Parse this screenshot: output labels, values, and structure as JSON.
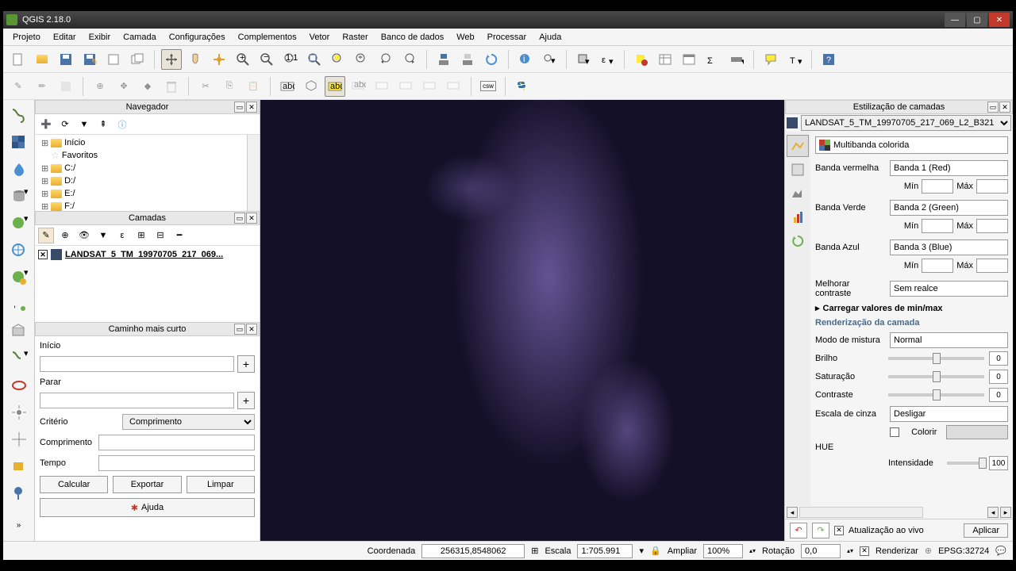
{
  "title": "QGIS 2.18.0",
  "menu": [
    "Projeto",
    "Editar",
    "Exibir",
    "Camada",
    "Configurações",
    "Complementos",
    "Vetor",
    "Raster",
    "Banco de dados",
    "Web",
    "Processar",
    "Ajuda"
  ],
  "panels": {
    "browser": {
      "title": "Navegador",
      "items": [
        {
          "exp": "⊞",
          "icon": "folder",
          "label": "Início"
        },
        {
          "exp": "",
          "icon": "star",
          "label": "Favoritos"
        },
        {
          "exp": "⊞",
          "icon": "folder",
          "label": "C:/"
        },
        {
          "exp": "⊞",
          "icon": "folder",
          "label": "D:/"
        },
        {
          "exp": "⊞",
          "icon": "folder",
          "label": "E:/"
        },
        {
          "exp": "⊞",
          "icon": "folder",
          "label": "F:/"
        }
      ]
    },
    "layers": {
      "title": "Camadas",
      "item": "LANDSAT_5_TM_19970705_217_069..."
    },
    "shortestPath": {
      "title": "Caminho mais curto",
      "start": "Início",
      "stop": "Parar",
      "criterion_label": "Critério",
      "criterion": "Comprimento",
      "length": "Comprimento",
      "time": "Tempo",
      "calc": "Calcular",
      "export": "Exportar",
      "clear": "Limpar",
      "help": "Ajuda"
    }
  },
  "style": {
    "title": "Estilização de camadas",
    "layer": "LANDSAT_5_TM_19970705_217_069_L2_B321",
    "renderer": "Multibanda colorida",
    "red_label": "Banda vermelha",
    "red": "Banda 1 (Red)",
    "green_label": "Banda Verde",
    "green": "Banda 2 (Green)",
    "blue_label": "Banda Azul",
    "blue": "Banda 3 (Blue)",
    "min": "Mín",
    "max": "Máx",
    "contrast_label": "Melhorar contraste",
    "contrast": "Sem realce",
    "load": "Carregar valores de min/max",
    "render_section": "Renderização da camada",
    "blend_label": "Modo de mistura",
    "blend": "Normal",
    "bright": "Brilho",
    "sat": "Saturação",
    "contr": "Contraste",
    "zero": "0",
    "gray_label": "Escala de cinza",
    "gray": "Desligar",
    "colorize": "Colorir",
    "hue": "HUE",
    "intensity": "Intensidade",
    "intensity_val": "100",
    "live": "Atualização ao vivo",
    "apply": "Aplicar"
  },
  "status": {
    "coord_label": "Coordenada",
    "coord": "256315,8548062",
    "scale_label": "Escala",
    "scale": "1:705.991",
    "zoom_label": "Ampliar",
    "zoom": "100%",
    "rot_label": "Rotação",
    "rot": "0,0",
    "render": "Renderizar",
    "epsg": "EPSG:32724"
  }
}
